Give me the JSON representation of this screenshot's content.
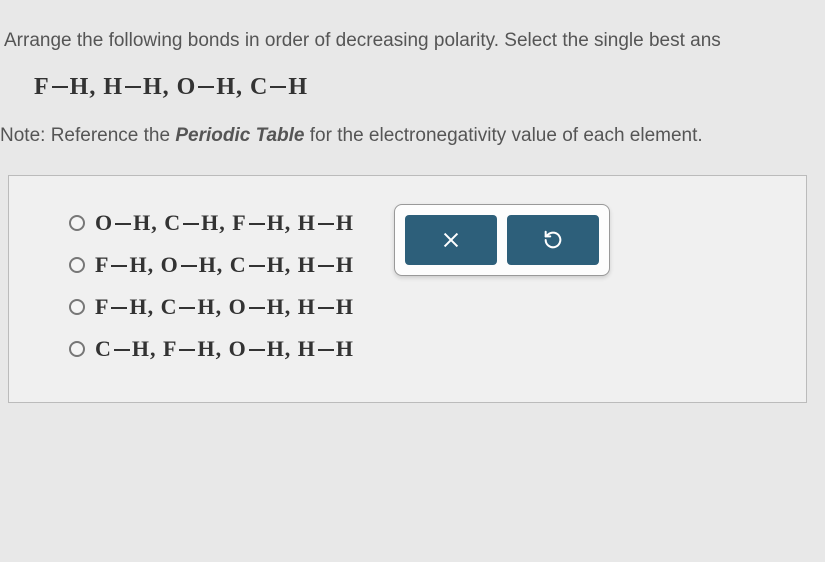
{
  "question": {
    "instruction": "Arrange the following bonds in order of decreasing polarity. Select the single best ans",
    "bonds_display": "F — H, H — H, O — H, C — H",
    "note_prefix": "Note: Reference the ",
    "note_emphasis": "Periodic Table",
    "note_suffix": " for the electronegativity value of each element."
  },
  "options": [
    {
      "label": "O — H, C — H, F — H, H — H"
    },
    {
      "label": "F — H, O — H, C — H, H — H"
    },
    {
      "label": "F — H, C — H, O — H, H — H"
    },
    {
      "label": "C — H, F — H, O — H, H — H"
    }
  ],
  "controls": {
    "close_icon": "close-icon",
    "reset_icon": "reset-icon"
  }
}
